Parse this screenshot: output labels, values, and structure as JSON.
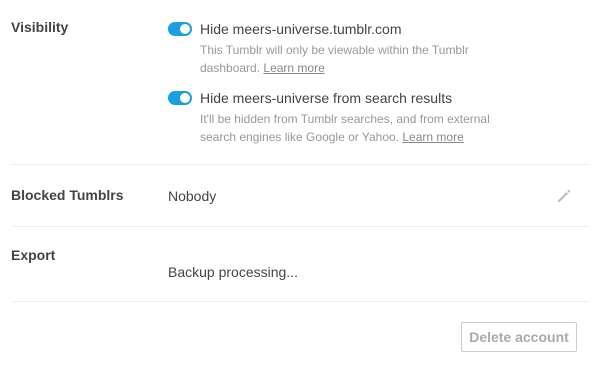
{
  "visibility": {
    "label": "Visibility",
    "hide_blog": {
      "label": "Hide meers-universe.tumblr.com",
      "enabled": true,
      "help_text": "This Tumblr will only be viewable within the Tumblr dashboard.",
      "learn_more": "Learn more"
    },
    "hide_search": {
      "label": "Hide meers-universe from search results",
      "enabled": true,
      "help_text_line1": "It'll be hidden from Tumblr searches, and from external",
      "help_text_line2": "search engines like Google or Yahoo.",
      "learn_more": "Learn more"
    }
  },
  "blocked": {
    "label": "Blocked Tumblrs",
    "value": "Nobody",
    "edit_icon": "pencil-icon"
  },
  "export": {
    "label": "Export",
    "status": "Backup processing..."
  },
  "delete_account": {
    "label": "Delete account"
  },
  "colors": {
    "toggle_on": "#1a9fe0",
    "text": "#444444",
    "help_text": "#999999",
    "divider": "#eeeeee"
  }
}
